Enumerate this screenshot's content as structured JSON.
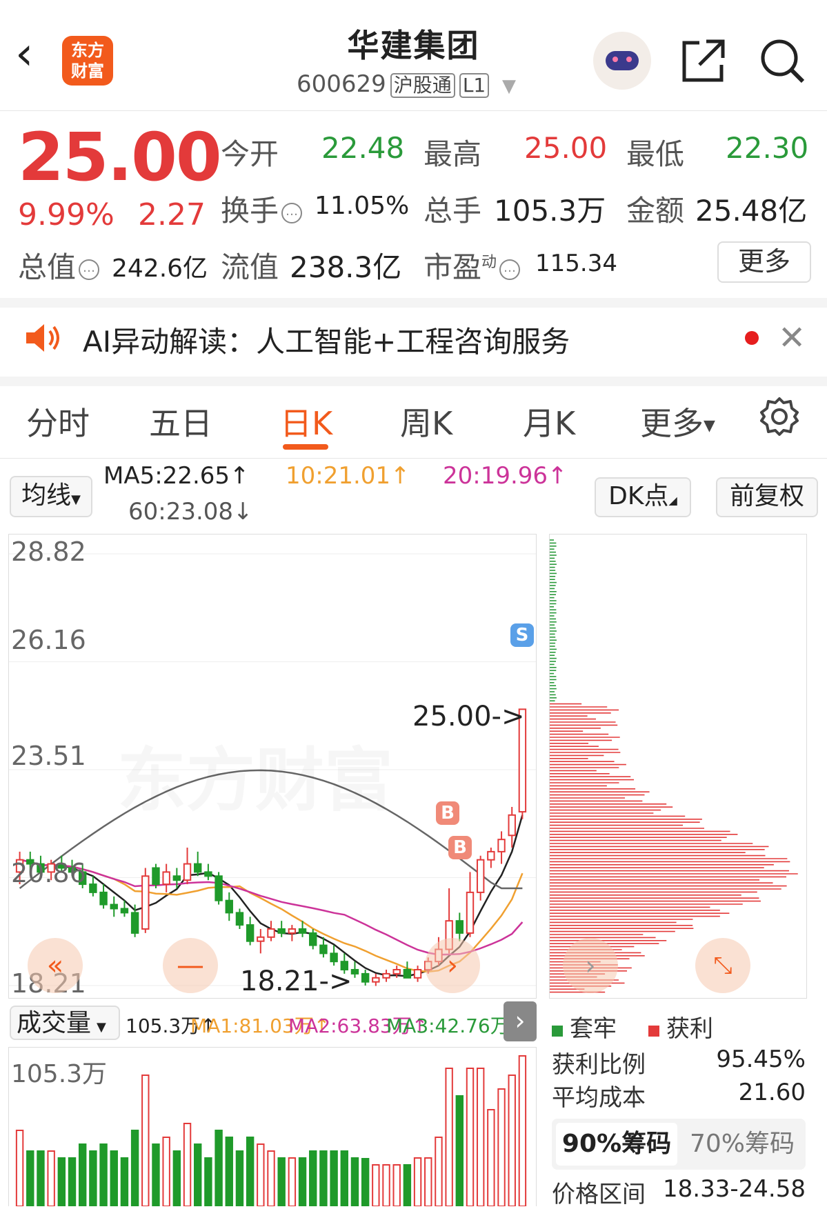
{
  "header": {
    "title": "华建集团",
    "code": "600629",
    "tag1": "沪股通",
    "tag2": "L1",
    "logo_line1": "东方",
    "logo_line2": "财富"
  },
  "quote": {
    "price": "25.00",
    "change_pct": "9.99%",
    "change": "2.27",
    "open_label": "今开",
    "open": "22.48",
    "high_label": "最高",
    "high": "25.00",
    "low_label": "最低",
    "low": "22.30",
    "turnover_label": "换手",
    "turnover": "11.05%",
    "volume_label": "总手",
    "volume": "105.3万",
    "amount_label": "金额",
    "amount": "25.48亿",
    "mktcap_label": "总值",
    "mktcap": "242.6亿",
    "float_label": "流值",
    "float_cap": "238.3亿",
    "pe_label": "市盈",
    "pe_sup": "动",
    "pe": "115.34",
    "more": "更多"
  },
  "ai_banner": {
    "text": "AI异动解读：人工智能+工程咨询服务"
  },
  "tabs": [
    "分时",
    "五日",
    "日K",
    "周K",
    "月K",
    "更多"
  ],
  "active_tab": "日K",
  "ma_bar": {
    "select": "均线",
    "ma5": "MA5:22.65↑",
    "ma10": "10:21.01↑",
    "ma20": "20:19.96↑",
    "ma60": "60:23.08↓",
    "dk": "DK点",
    "adjust": "前复权",
    "colors": {
      "ma5": "#222222",
      "ma10": "#f0a030",
      "ma20": "#cc3399",
      "ma60": "#666666"
    }
  },
  "kline": {
    "y_ticks": [
      "28.82",
      "26.16",
      "23.51",
      "20.86",
      "18.21"
    ],
    "annot_high": "25.00->",
    "annot_low": "18.21->",
    "marker_s": "S",
    "marker_b": "B",
    "watermark": "东方财富"
  },
  "volume": {
    "select": "成交量",
    "vol": "105.3万↑",
    "ma1": "MA1:81.03万↑",
    "ma2": "MA2:63.83万↑",
    "ma3": "MA3:42.76万↑",
    "y_top": "105.3万"
  },
  "chips": {
    "legend_trapped": "套牢",
    "legend_profit": "获利",
    "profit_ratio_label": "获利比例",
    "profit_ratio": "95.45%",
    "avg_cost_label": "平均成本",
    "avg_cost": "21.60",
    "seg_on": "90%筹码",
    "seg_off": "70%筹码",
    "range_label": "价格区间",
    "range": "18.33-24.58"
  },
  "chart_data": {
    "type": "candlestick",
    "y_range": [
      18.21,
      28.82
    ],
    "candles": [
      [
        21.0,
        21.5,
        20.7,
        21.3
      ],
      [
        21.3,
        21.5,
        21.0,
        21.2
      ],
      [
        21.2,
        21.4,
        20.9,
        21.0
      ],
      [
        21.0,
        21.3,
        20.8,
        21.2
      ],
      [
        21.2,
        21.4,
        21.0,
        21.1
      ],
      [
        21.1,
        21.3,
        20.9,
        21.0
      ],
      [
        21.0,
        21.2,
        20.6,
        20.7
      ],
      [
        20.7,
        20.9,
        20.4,
        20.5
      ],
      [
        20.5,
        20.7,
        20.1,
        20.2
      ],
      [
        20.2,
        20.4,
        19.9,
        20.1
      ],
      [
        20.1,
        20.3,
        19.9,
        20.0
      ],
      [
        20.0,
        20.2,
        19.4,
        19.5
      ],
      [
        19.6,
        21.1,
        19.5,
        20.9
      ],
      [
        21.1,
        21.2,
        20.6,
        20.7
      ],
      [
        20.7,
        21.2,
        20.5,
        21.0
      ],
      [
        20.9,
        21.1,
        20.6,
        20.8
      ],
      [
        20.8,
        21.6,
        20.7,
        21.2
      ],
      [
        21.2,
        21.5,
        20.9,
        21.0
      ],
      [
        21.0,
        21.2,
        20.8,
        20.9
      ],
      [
        20.9,
        21.0,
        20.2,
        20.3
      ],
      [
        20.3,
        20.5,
        19.8,
        20.0
      ],
      [
        20.0,
        20.1,
        19.6,
        19.7
      ],
      [
        19.7,
        19.9,
        19.2,
        19.3
      ],
      [
        19.3,
        19.6,
        19.0,
        19.4
      ],
      [
        19.4,
        19.8,
        19.3,
        19.6
      ],
      [
        19.6,
        19.8,
        19.4,
        19.5
      ],
      [
        19.5,
        19.7,
        19.3,
        19.6
      ],
      [
        19.6,
        19.8,
        19.4,
        19.5
      ],
      [
        19.5,
        19.6,
        19.1,
        19.2
      ],
      [
        19.2,
        19.4,
        18.9,
        19.0
      ],
      [
        19.0,
        19.2,
        18.7,
        18.8
      ],
      [
        18.8,
        19.0,
        18.5,
        18.6
      ],
      [
        18.6,
        18.8,
        18.4,
        18.5
      ],
      [
        18.5,
        18.6,
        18.21,
        18.3
      ],
      [
        18.3,
        18.5,
        18.2,
        18.4
      ],
      [
        18.4,
        18.6,
        18.3,
        18.5
      ],
      [
        18.5,
        18.7,
        18.4,
        18.6
      ],
      [
        18.6,
        18.8,
        18.5,
        18.4
      ],
      [
        18.4,
        18.7,
        18.3,
        18.6
      ],
      [
        18.6,
        18.9,
        18.5,
        18.8
      ],
      [
        18.8,
        19.4,
        18.7,
        19.1
      ],
      [
        19.1,
        20.6,
        19.0,
        19.8
      ],
      [
        19.8,
        20.0,
        19.3,
        19.5
      ],
      [
        19.5,
        21.0,
        19.4,
        20.5
      ],
      [
        20.5,
        21.4,
        20.3,
        21.3
      ],
      [
        21.3,
        21.6,
        21.1,
        21.5
      ],
      [
        21.5,
        22.0,
        21.2,
        21.8
      ],
      [
        21.9,
        22.6,
        21.6,
        22.4
      ],
      [
        22.48,
        25.0,
        22.3,
        25.0
      ]
    ]
  }
}
